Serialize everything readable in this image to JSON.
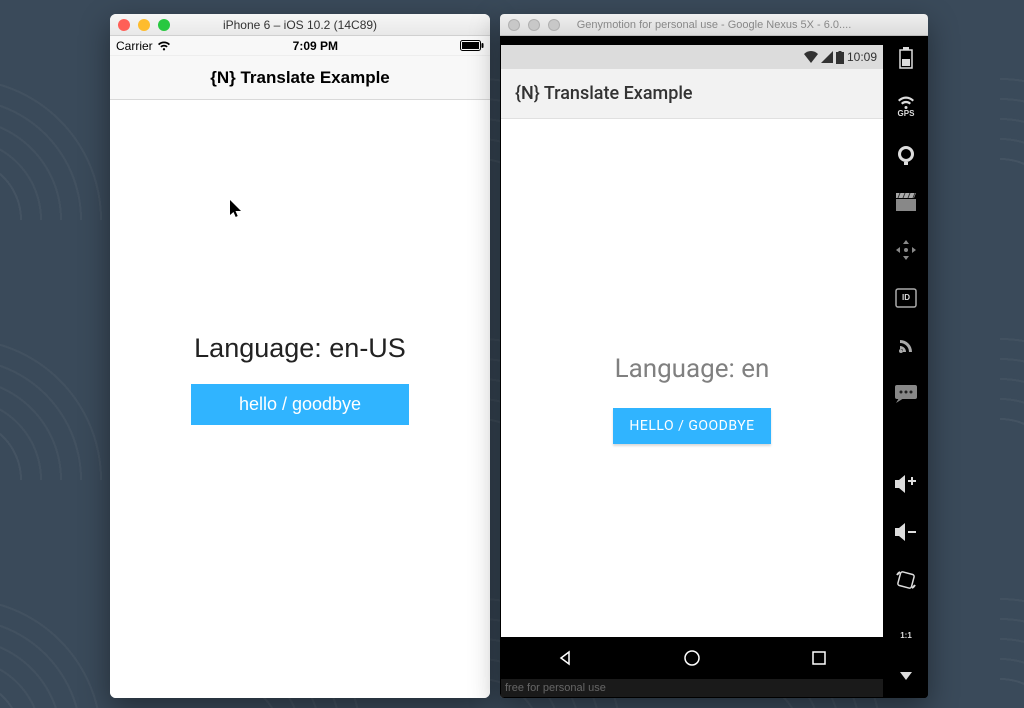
{
  "ios": {
    "window_title": "iPhone 6 – iOS 10.2 (14C89)",
    "statusbar": {
      "carrier": "Carrier",
      "time": "7:09 PM"
    },
    "nav_title": "{N} Translate Example",
    "language_label": "Language: en-US",
    "button_label": "hello / goodbye"
  },
  "android": {
    "window_title": "Genymotion for personal use - Google Nexus 5X - 6.0....",
    "statusbar": {
      "time": "10:09"
    },
    "app_title": "{N} Translate Example",
    "language_label": "Language: en",
    "button_label": "HELLO / GOODBYE",
    "footer_text": "free for personal use"
  },
  "geny_sidebar": {
    "gps_label": "GPS",
    "id_label": "ID",
    "scale_label": "1:1"
  },
  "colors": {
    "accent": "#30b4ff"
  }
}
